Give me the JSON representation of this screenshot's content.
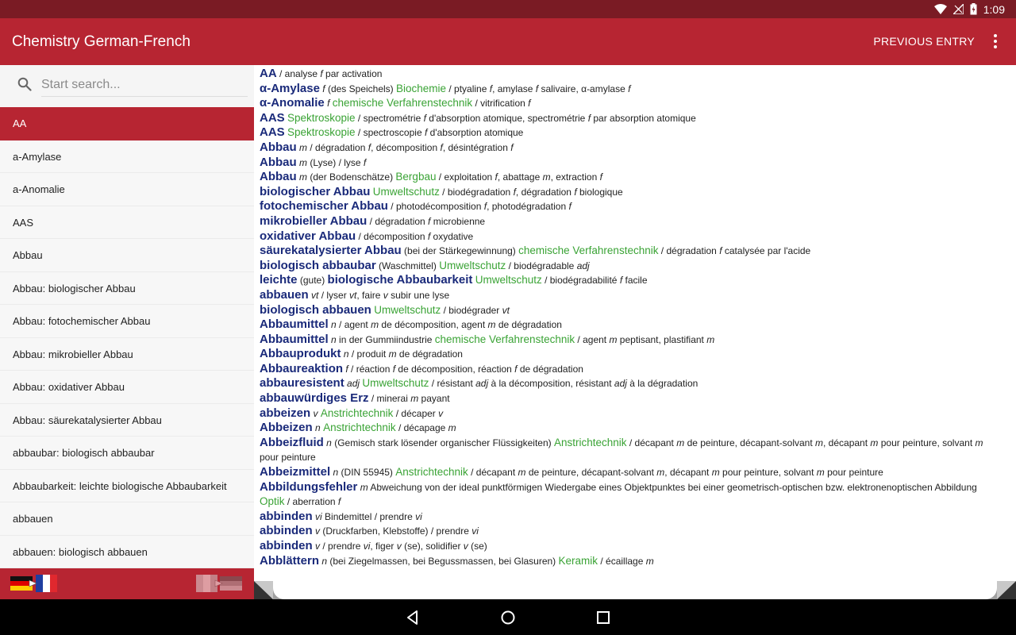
{
  "status": {
    "time": "1:09"
  },
  "app": {
    "title": "Chemistry German-French",
    "previous_entry": "PREVIOUS ENTRY"
  },
  "search": {
    "placeholder": "Start search..."
  },
  "sidebar": {
    "items": [
      {
        "label": "AA"
      },
      {
        "label": "a-Amylase"
      },
      {
        "label": "a-Anomalie"
      },
      {
        "label": "AAS"
      },
      {
        "label": "Abbau"
      },
      {
        "label": "Abbau: biologischer Abbau"
      },
      {
        "label": "Abbau: fotochemischer Abbau"
      },
      {
        "label": "Abbau: mikrobieller Abbau"
      },
      {
        "label": "Abbau: oxidativer Abbau"
      },
      {
        "label": "Abbau: säurekatalysierter Abbau"
      },
      {
        "label": "abbaubar: biologisch abbaubar"
      },
      {
        "label": "Abbaubarkeit: leichte biologische Abbaubarkeit"
      },
      {
        "label": "abbauen"
      },
      {
        "label": "abbauen: biologisch abbauen"
      }
    ],
    "selected_index": 0
  },
  "entries": [
    [
      [
        "h",
        "AA"
      ],
      [
        "t",
        " / analyse "
      ],
      [
        "g",
        "f"
      ],
      [
        "t",
        " par activation"
      ]
    ],
    [
      [
        "h",
        "α-Amylase"
      ],
      [
        "t",
        " "
      ],
      [
        "g",
        "f"
      ],
      [
        "t",
        " (des Speichels) "
      ],
      [
        "d",
        "Biochemie"
      ],
      [
        "t",
        " / ptyaline "
      ],
      [
        "g",
        "f"
      ],
      [
        "t",
        ", amylase "
      ],
      [
        "g",
        "f"
      ],
      [
        "t",
        " salivaire, α-amylase "
      ],
      [
        "g",
        "f"
      ]
    ],
    [
      [
        "h",
        "α-Anomalie"
      ],
      [
        "t",
        " "
      ],
      [
        "g",
        "f"
      ],
      [
        "t",
        " "
      ],
      [
        "d",
        "chemische Verfahrenstechnik"
      ],
      [
        "t",
        " / vitrification "
      ],
      [
        "g",
        "f"
      ]
    ],
    [
      [
        "h",
        "AAS"
      ],
      [
        "t",
        " "
      ],
      [
        "d",
        "Spektroskopie"
      ],
      [
        "t",
        " / spectrométrie "
      ],
      [
        "g",
        "f"
      ],
      [
        "t",
        " d'absorption atomique, spectrométrie "
      ],
      [
        "g",
        "f"
      ],
      [
        "t",
        " par absorption atomique"
      ]
    ],
    [
      [
        "h",
        "AAS"
      ],
      [
        "t",
        " "
      ],
      [
        "d",
        "Spektroskopie"
      ],
      [
        "t",
        " / spectroscopie "
      ],
      [
        "g",
        "f"
      ],
      [
        "t",
        " d'absorption atomique"
      ]
    ],
    [
      [
        "h",
        "Abbau"
      ],
      [
        "t",
        " "
      ],
      [
        "g",
        "m"
      ],
      [
        "t",
        " / dégradation "
      ],
      [
        "g",
        "f"
      ],
      [
        "t",
        ", décomposition "
      ],
      [
        "g",
        "f"
      ],
      [
        "t",
        ", désintégration "
      ],
      [
        "g",
        "f"
      ]
    ],
    [
      [
        "h",
        "Abbau"
      ],
      [
        "t",
        " "
      ],
      [
        "g",
        "m"
      ],
      [
        "t",
        " (Lyse) / lyse "
      ],
      [
        "g",
        "f"
      ]
    ],
    [
      [
        "h",
        "Abbau"
      ],
      [
        "t",
        " "
      ],
      [
        "g",
        "m"
      ],
      [
        "t",
        " (der Bodenschätze) "
      ],
      [
        "d",
        "Bergbau"
      ],
      [
        "t",
        " / exploitation "
      ],
      [
        "g",
        "f"
      ],
      [
        "t",
        ", abattage "
      ],
      [
        "g",
        "m"
      ],
      [
        "t",
        ", extraction "
      ],
      [
        "g",
        "f"
      ]
    ],
    [
      [
        "h",
        "biologischer Abbau"
      ],
      [
        "t",
        " "
      ],
      [
        "d",
        "Umweltschutz"
      ],
      [
        "t",
        " / biodégradation "
      ],
      [
        "g",
        "f"
      ],
      [
        "t",
        ", dégradation "
      ],
      [
        "g",
        "f"
      ],
      [
        "t",
        " biologique"
      ]
    ],
    [
      [
        "h",
        "fotochemischer Abbau"
      ],
      [
        "t",
        " / photodécomposition "
      ],
      [
        "g",
        "f"
      ],
      [
        "t",
        ", photodégradation "
      ],
      [
        "g",
        "f"
      ]
    ],
    [
      [
        "h",
        "mikrobieller Abbau"
      ],
      [
        "t",
        " / dégradation "
      ],
      [
        "g",
        "f"
      ],
      [
        "t",
        " microbienne"
      ]
    ],
    [
      [
        "h",
        "oxidativer Abbau"
      ],
      [
        "t",
        " / décomposition "
      ],
      [
        "g",
        "f"
      ],
      [
        "t",
        " oxydative"
      ]
    ],
    [
      [
        "h",
        "säurekatalysierter Abbau"
      ],
      [
        "t",
        " (bei der Stärkegewinnung) "
      ],
      [
        "d",
        "chemische Verfahrenstechnik"
      ],
      [
        "t",
        " / dégradation "
      ],
      [
        "g",
        "f"
      ],
      [
        "t",
        " catalysée par l'acide"
      ]
    ],
    [
      [
        "h",
        "biologisch abbaubar"
      ],
      [
        "t",
        " (Waschmittel) "
      ],
      [
        "d",
        "Umweltschutz"
      ],
      [
        "t",
        " / biodégradable "
      ],
      [
        "g",
        "adj"
      ]
    ],
    [
      [
        "h",
        "leichte"
      ],
      [
        "t",
        " (gute) "
      ],
      [
        "h",
        "biologische Abbaubarkeit"
      ],
      [
        "t",
        " "
      ],
      [
        "d",
        "Umweltschutz"
      ],
      [
        "t",
        " / biodégradabilité "
      ],
      [
        "g",
        "f"
      ],
      [
        "t",
        " facile"
      ]
    ],
    [
      [
        "h",
        "abbauen"
      ],
      [
        "t",
        " "
      ],
      [
        "g",
        "vt"
      ],
      [
        "t",
        " / lyser "
      ],
      [
        "g",
        "vt"
      ],
      [
        "t",
        ", faire "
      ],
      [
        "g",
        "v"
      ],
      [
        "t",
        " subir une lyse"
      ]
    ],
    [
      [
        "h",
        "biologisch abbauen"
      ],
      [
        "t",
        " "
      ],
      [
        "d",
        "Umweltschutz"
      ],
      [
        "t",
        " / biodégrader "
      ],
      [
        "g",
        "vt"
      ]
    ],
    [
      [
        "h",
        "Abbaumittel"
      ],
      [
        "t",
        " "
      ],
      [
        "g",
        "n"
      ],
      [
        "t",
        " / agent "
      ],
      [
        "g",
        "m"
      ],
      [
        "t",
        " de décomposition, agent "
      ],
      [
        "g",
        "m"
      ],
      [
        "t",
        " de dégradation"
      ]
    ],
    [
      [
        "h",
        "Abbaumittel"
      ],
      [
        "t",
        " "
      ],
      [
        "g",
        "n"
      ],
      [
        "t",
        " in der Gummiindustrie "
      ],
      [
        "d",
        "chemische Verfahrenstechnik"
      ],
      [
        "t",
        " / agent "
      ],
      [
        "g",
        "m"
      ],
      [
        "t",
        " peptisant, plastifiant "
      ],
      [
        "g",
        "m"
      ]
    ],
    [
      [
        "h",
        "Abbauprodukt"
      ],
      [
        "t",
        " "
      ],
      [
        "g",
        "n"
      ],
      [
        "t",
        " / produit "
      ],
      [
        "g",
        "m"
      ],
      [
        "t",
        " de dégradation"
      ]
    ],
    [
      [
        "h",
        "Abbaureaktion"
      ],
      [
        "t",
        " "
      ],
      [
        "g",
        "f"
      ],
      [
        "t",
        " / réaction "
      ],
      [
        "g",
        "f"
      ],
      [
        "t",
        " de décomposition, réaction "
      ],
      [
        "g",
        "f"
      ],
      [
        "t",
        " de dégradation"
      ]
    ],
    [
      [
        "h",
        "abbauresistent"
      ],
      [
        "t",
        " "
      ],
      [
        "g",
        "adj"
      ],
      [
        "t",
        " "
      ],
      [
        "d",
        "Umweltschutz"
      ],
      [
        "t",
        " / résistant "
      ],
      [
        "g",
        "adj"
      ],
      [
        "t",
        " à la décomposition, résistant "
      ],
      [
        "g",
        "adj"
      ],
      [
        "t",
        " à la dégradation"
      ]
    ],
    [
      [
        "h",
        "abbauwürdiges Erz"
      ],
      [
        "t",
        " / minerai "
      ],
      [
        "g",
        "m"
      ],
      [
        "t",
        " payant"
      ]
    ],
    [
      [
        "h",
        "abbeizen"
      ],
      [
        "t",
        " "
      ],
      [
        "g",
        "v"
      ],
      [
        "t",
        " "
      ],
      [
        "d",
        "Anstrichtechnik"
      ],
      [
        "t",
        " / décaper "
      ],
      [
        "g",
        "v"
      ]
    ],
    [
      [
        "h",
        "Abbeizen"
      ],
      [
        "t",
        " "
      ],
      [
        "g",
        "n"
      ],
      [
        "t",
        " "
      ],
      [
        "d",
        "Anstrichtechnik"
      ],
      [
        "t",
        " / décapage "
      ],
      [
        "g",
        "m"
      ]
    ],
    [
      [
        "h",
        "Abbeizfluid"
      ],
      [
        "t",
        " "
      ],
      [
        "g",
        "n"
      ],
      [
        "t",
        " (Gemisch stark lösender organischer Flüssigkeiten) "
      ],
      [
        "d",
        "Anstrichtechnik"
      ],
      [
        "t",
        " / décapant "
      ],
      [
        "g",
        "m"
      ],
      [
        "t",
        " de peinture, décapant-solvant "
      ],
      [
        "g",
        "m"
      ],
      [
        "t",
        ", décapant "
      ],
      [
        "g",
        "m"
      ],
      [
        "t",
        " pour peinture, solvant "
      ],
      [
        "g",
        "m"
      ],
      [
        "t",
        " pour peinture"
      ]
    ],
    [
      [
        "h",
        "Abbeizmittel"
      ],
      [
        "t",
        " "
      ],
      [
        "g",
        "n"
      ],
      [
        "t",
        " (DIN 55945) "
      ],
      [
        "d",
        "Anstrichtechnik"
      ],
      [
        "t",
        " / décapant "
      ],
      [
        "g",
        "m"
      ],
      [
        "t",
        " de peinture, décapant-solvant "
      ],
      [
        "g",
        "m"
      ],
      [
        "t",
        ", décapant "
      ],
      [
        "g",
        "m"
      ],
      [
        "t",
        " pour peinture, solvant "
      ],
      [
        "g",
        "m"
      ],
      [
        "t",
        " pour peinture"
      ]
    ],
    [
      [
        "h",
        "Abbildungsfehler"
      ],
      [
        "t",
        " "
      ],
      [
        "g",
        "m"
      ],
      [
        "t",
        " Abweichung von der ideal punktförmigen Wiedergabe eines Objektpunktes bei einer geometrisch-optischen bzw. elektronenoptischen Abbildung "
      ],
      [
        "d",
        "Optik"
      ],
      [
        "t",
        " / aberration "
      ],
      [
        "g",
        "f"
      ]
    ],
    [
      [
        "h",
        "abbinden"
      ],
      [
        "t",
        " "
      ],
      [
        "g",
        "vi"
      ],
      [
        "t",
        " Bindemittel / prendre "
      ],
      [
        "g",
        "vi"
      ]
    ],
    [
      [
        "h",
        "abbinden"
      ],
      [
        "t",
        " "
      ],
      [
        "g",
        "v"
      ],
      [
        "t",
        " (Druckfarben, Klebstoffe) / prendre "
      ],
      [
        "g",
        "vi"
      ]
    ],
    [
      [
        "h",
        "abbinden"
      ],
      [
        "t",
        " "
      ],
      [
        "g",
        "v"
      ],
      [
        "t",
        " / prendre "
      ],
      [
        "g",
        "vi"
      ],
      [
        "t",
        ", figer "
      ],
      [
        "g",
        "v"
      ],
      [
        "t",
        " (se), solidifier "
      ],
      [
        "g",
        "v"
      ],
      [
        "t",
        " (se)"
      ]
    ],
    [
      [
        "h",
        "Abblättern"
      ],
      [
        "t",
        " "
      ],
      [
        "g",
        "n"
      ],
      [
        "t",
        " (bei Ziegelmassen, bei Begussmassen, bei Glasuren) "
      ],
      [
        "d",
        "Keramik"
      ],
      [
        "t",
        " / écaillage "
      ],
      [
        "g",
        "m"
      ]
    ]
  ],
  "icons": {
    "wifi": "wifi-icon",
    "signal": "no-signal-icon",
    "battery": "battery-charging-icon",
    "search": "search-icon",
    "menu": "overflow-menu-icon",
    "flag_de_fr": "flag-german-to-french-icon",
    "flag_fr_de": "flag-french-to-german-icon",
    "back": "back-icon",
    "home": "home-icon",
    "recents": "recents-icon"
  },
  "colors": {
    "statusbar": "#7a1b24",
    "appbar": "#b72532",
    "headword": "#1a2a7a",
    "domain": "#3aa335"
  }
}
